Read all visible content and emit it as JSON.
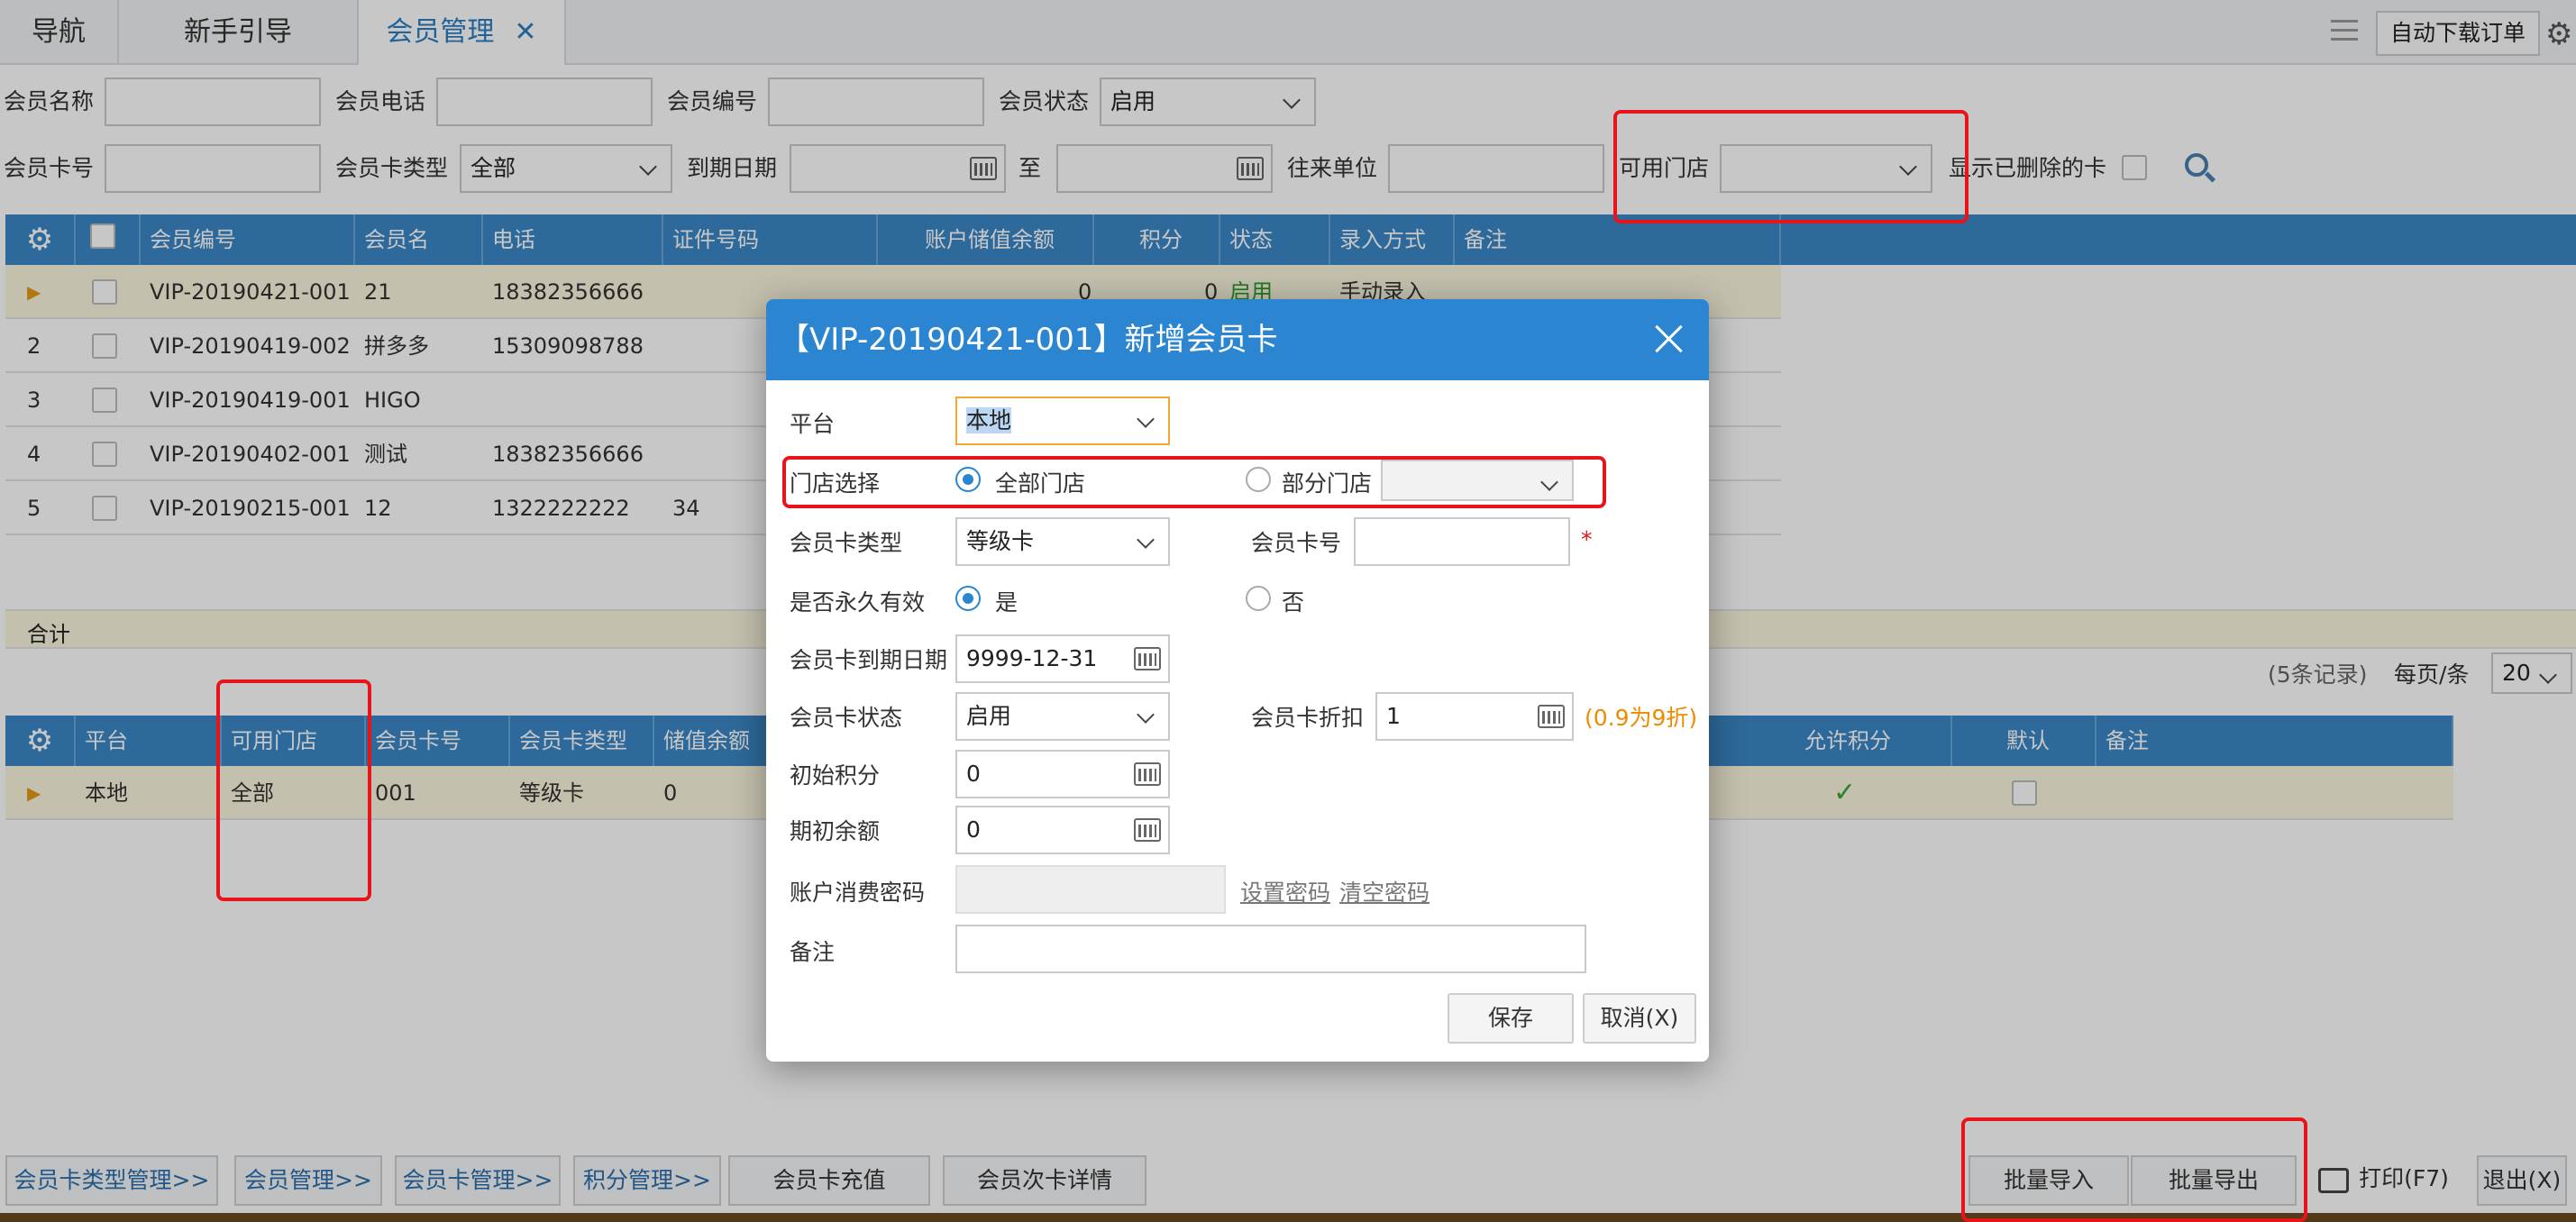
{
  "tabs": [
    {
      "label": "导航"
    },
    {
      "label": "新手引导"
    },
    {
      "label": "会员管理"
    }
  ],
  "header_right": {
    "auto_download": "自动下载订单"
  },
  "filters": {
    "member_name": "会员名称",
    "member_phone": "会员电话",
    "member_no": "会员编号",
    "member_status": "会员状态",
    "member_status_value": "启用",
    "card_no": "会员卡号",
    "card_type": "会员卡类型",
    "card_type_value": "全部",
    "expire_date": "到期日期",
    "to": "至",
    "partner": "往来单位",
    "store": "可用门店",
    "show_deleted": "显示已删除的卡"
  },
  "member_table": {
    "headers": [
      "会员编号",
      "会员名",
      "电话",
      "证件号码",
      "账户储值余额",
      "积分",
      "状态",
      "录入方式",
      "备注"
    ],
    "rows": [
      {
        "idx": "",
        "code": "VIP-20190421-001",
        "name": "21",
        "phone": "18382356666",
        "id": "",
        "balance": "0",
        "points": "0",
        "status": "启用",
        "entry": "手动录入"
      },
      {
        "idx": "2",
        "code": "VIP-20190419-002",
        "name": "拼多多",
        "phone": "15309098788",
        "id": "",
        "balance": "",
        "points": "",
        "status": "",
        "entry": ""
      },
      {
        "idx": "3",
        "code": "VIP-20190419-001",
        "name": "HIGO",
        "phone": "",
        "id": "",
        "balance": "",
        "points": "",
        "status": "",
        "entry": ""
      },
      {
        "idx": "4",
        "code": "VIP-20190402-001",
        "name": "测试",
        "phone": "18382356666",
        "id": "",
        "balance": "",
        "points": "",
        "status": "",
        "entry": ""
      },
      {
        "idx": "5",
        "code": "VIP-20190215-001",
        "name": "12",
        "phone": "1322222222",
        "id": "34",
        "balance": "",
        "points": "",
        "status": "",
        "entry": ""
      }
    ],
    "total_label": "合计",
    "records": "(5条记录)",
    "per_page_label": "每页/条",
    "per_page": "20"
  },
  "card_table": {
    "headers": [
      "平台",
      "可用门店",
      "会员卡号",
      "会员卡类型",
      "储值余额",
      "允许积分",
      "默认",
      "备注"
    ],
    "row": {
      "platform": "本地",
      "store": "全部",
      "card_no": "001",
      "type": "等级卡",
      "balance": "0"
    }
  },
  "dialog": {
    "title": "【VIP-20190421-001】新增会员卡",
    "platform_label": "平台",
    "platform_value": "本地",
    "store_label": "门店选择",
    "all_stores": "全部门店",
    "part_stores": "部分门店",
    "card_type_label": "会员卡类型",
    "card_type_value": "等级卡",
    "card_no_label": "会员卡号",
    "required": "*",
    "permanent_label": "是否永久有效",
    "yes": "是",
    "no": "否",
    "expire_label": "会员卡到期日期",
    "expire_value": "9999-12-31",
    "status_label": "会员卡状态",
    "status_value": "启用",
    "discount_label": "会员卡折扣",
    "discount_value": "1",
    "discount_hint": "(0.9为9折)",
    "init_points_label": "初始积分",
    "init_points_value": "0",
    "init_balance_label": "期初余额",
    "init_balance_value": "0",
    "password_label": "账户消费密码",
    "set_password": "设置密码",
    "clear_password": "清空密码",
    "remark_label": "备注",
    "save": "保存",
    "cancel": "取消(X)"
  },
  "footer": {
    "buttons": [
      "会员卡类型管理>>",
      "会员管理>>",
      "会员卡管理>>",
      "积分管理>>",
      "会员卡充值",
      "会员次卡详情"
    ],
    "import": "批量导入",
    "export": "批量导出",
    "print": "打印(F7)",
    "exit": "退出(X)"
  },
  "colors": {
    "header_blue": "#3a87c6",
    "dialog_blue": "#2b85d0",
    "highlight_red": "#e8141a"
  }
}
